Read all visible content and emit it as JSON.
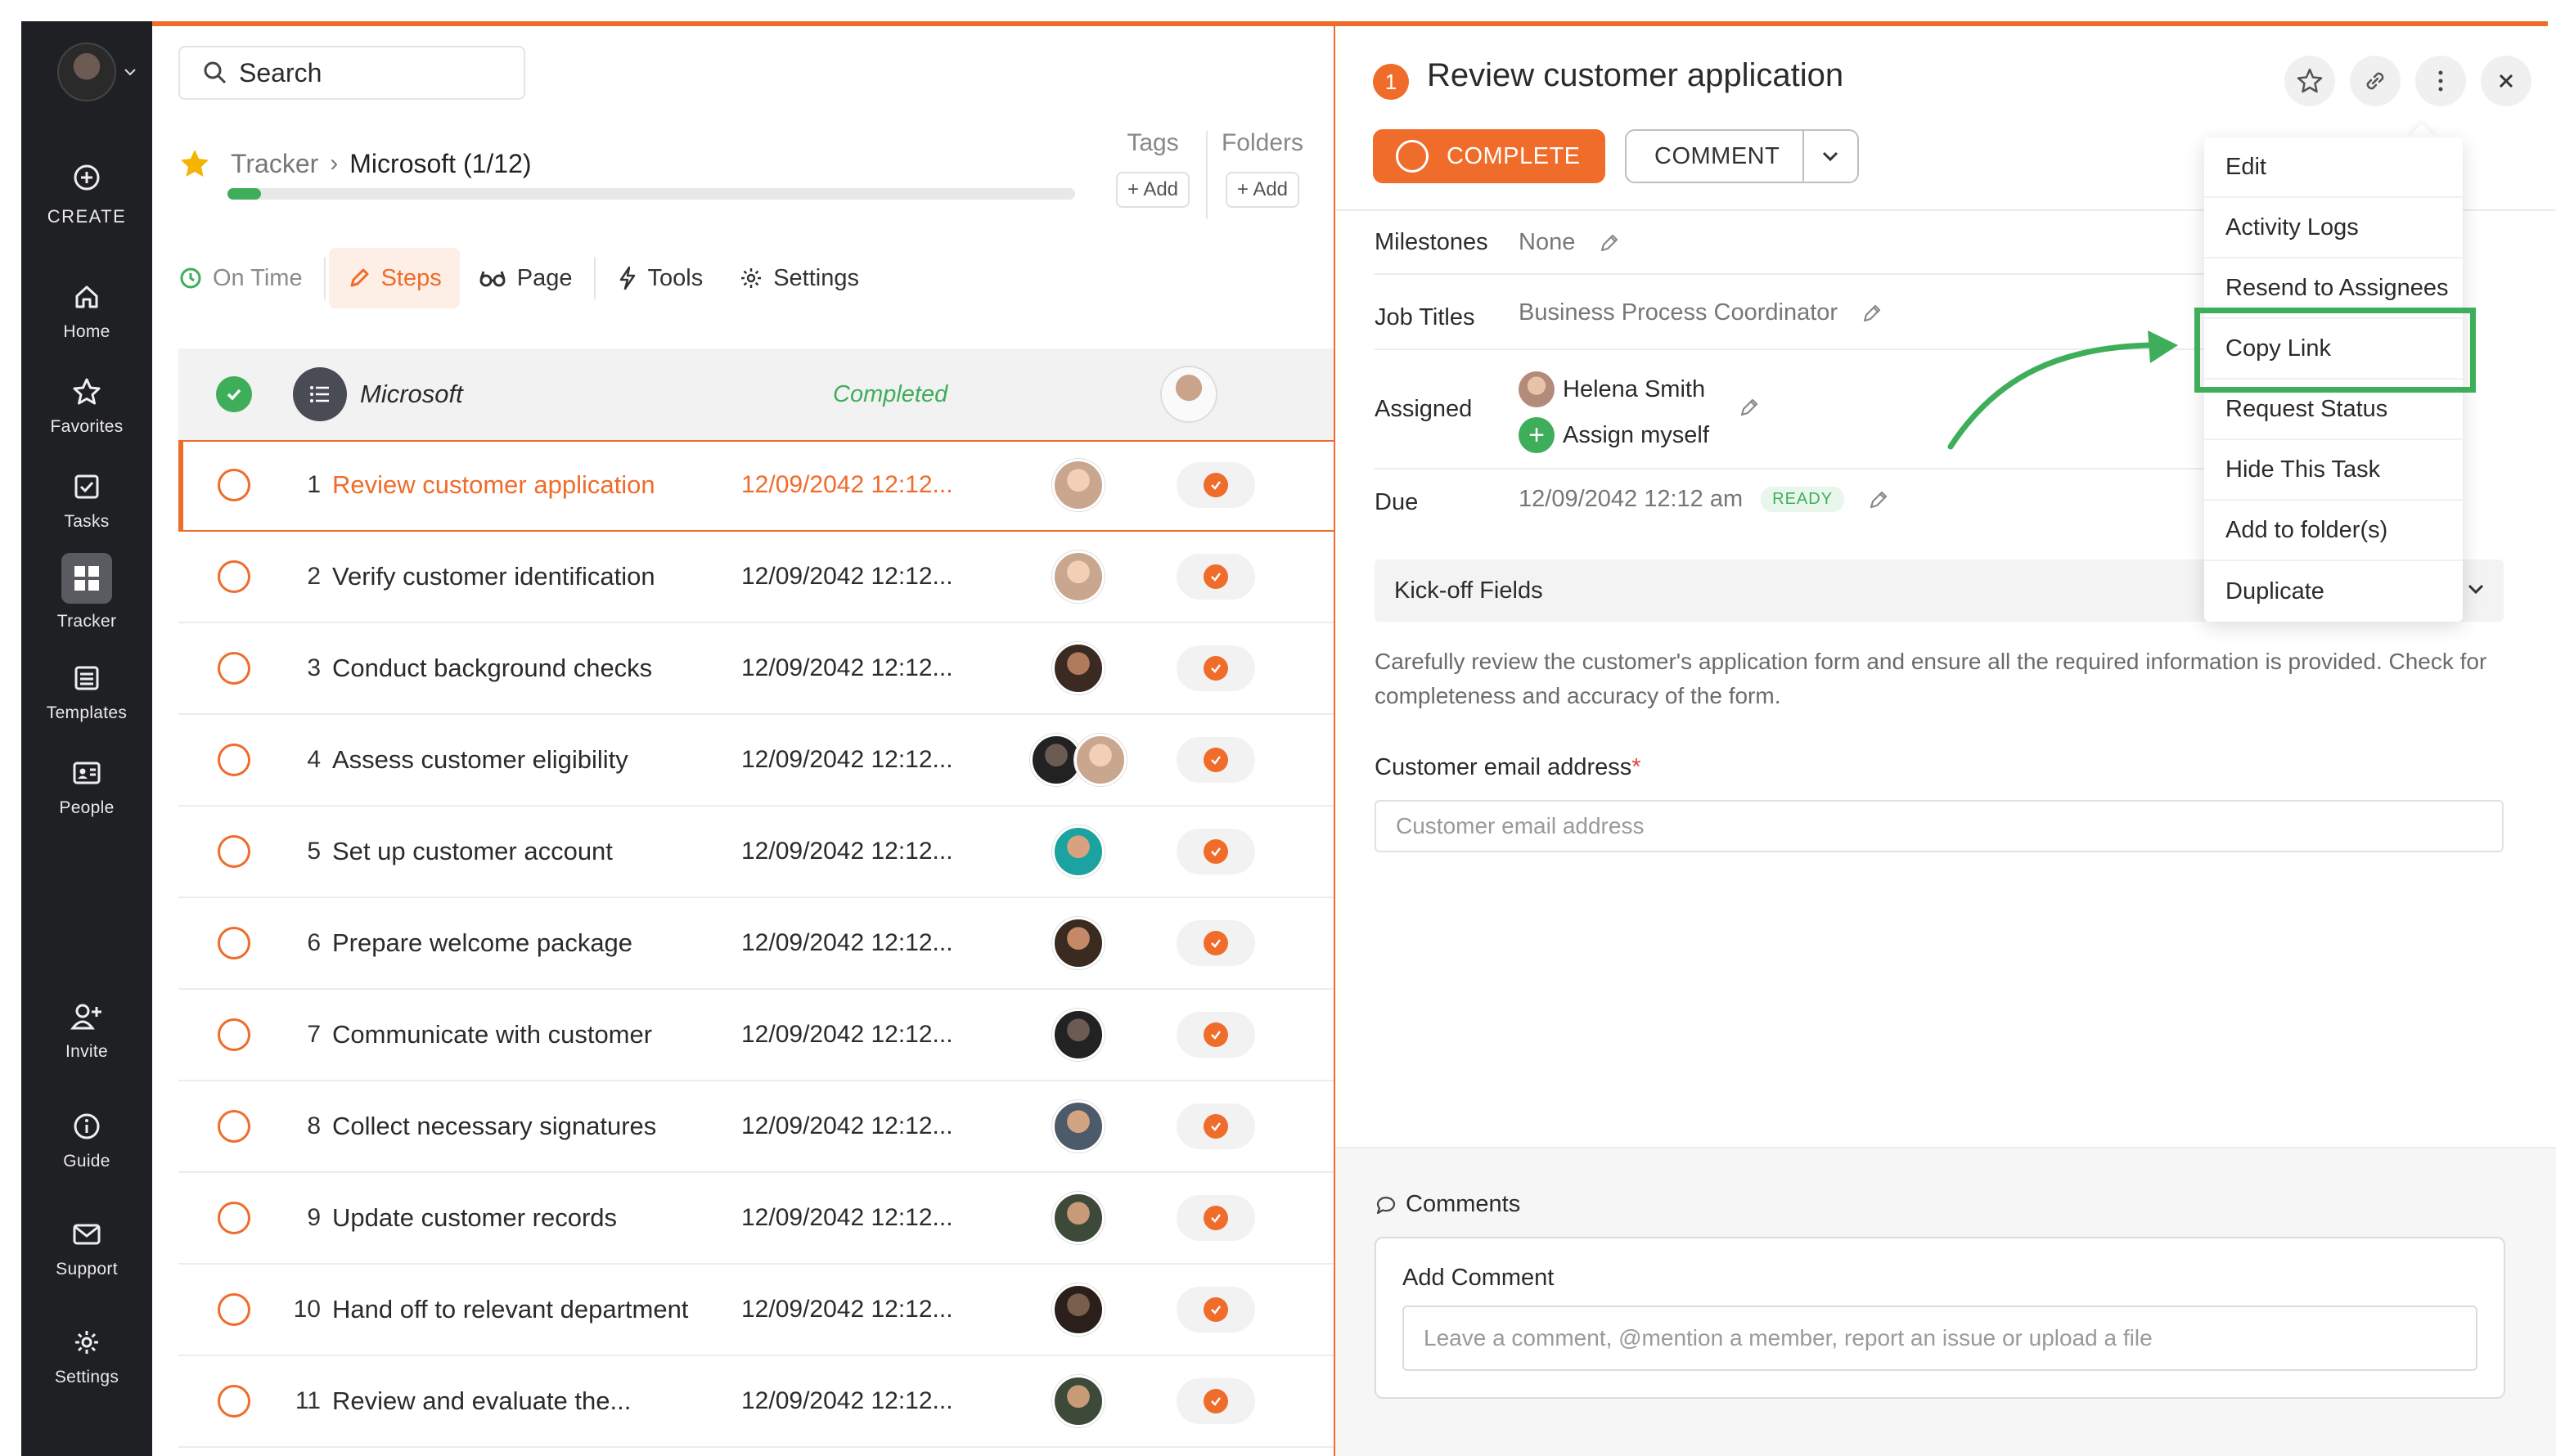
{
  "sidebar": {
    "create": "CREATE",
    "items": [
      {
        "label": "Home",
        "icon": "home-icon"
      },
      {
        "label": "Favorites",
        "icon": "star-icon"
      },
      {
        "label": "Tasks",
        "icon": "checkbox-icon"
      },
      {
        "label": "Tracker",
        "icon": "tracker-grid-icon"
      },
      {
        "label": "Templates",
        "icon": "templates-icon"
      },
      {
        "label": "People",
        "icon": "id-card-icon"
      }
    ],
    "bottom": [
      {
        "label": "Invite",
        "icon": "add-user-icon"
      },
      {
        "label": "Guide",
        "icon": "info-icon"
      },
      {
        "label": "Support",
        "icon": "mail-icon"
      },
      {
        "label": "Settings",
        "icon": "gear-icon"
      }
    ]
  },
  "search": {
    "label": "Search"
  },
  "breadcrumb": {
    "root": "Tracker",
    "sep": "›",
    "current": "Microsoft (1/12)",
    "progress": 0.04
  },
  "tags": {
    "title": "Tags",
    "add": "+ Add"
  },
  "folders": {
    "title": "Folders",
    "add": "+ Add"
  },
  "tabs": {
    "ontime": "On Time",
    "steps": "Steps",
    "page": "Page",
    "tools": "Tools",
    "settings": "Settings"
  },
  "group": {
    "name": "Microsoft",
    "status": "Completed"
  },
  "tasks": [
    {
      "num": "1",
      "title": "Review customer application",
      "date": "12/09/2042 12:12..."
    },
    {
      "num": "2",
      "title": "Verify customer identification",
      "date": "12/09/2042 12:12..."
    },
    {
      "num": "3",
      "title": "Conduct background checks",
      "date": "12/09/2042 12:12..."
    },
    {
      "num": "4",
      "title": "Assess customer eligibility",
      "date": "12/09/2042 12:12..."
    },
    {
      "num": "5",
      "title": "Set up customer account",
      "date": "12/09/2042 12:12..."
    },
    {
      "num": "6",
      "title": "Prepare welcome package",
      "date": "12/09/2042 12:12..."
    },
    {
      "num": "7",
      "title": "Communicate with customer",
      "date": "12/09/2042 12:12..."
    },
    {
      "num": "8",
      "title": "Collect necessary signatures",
      "date": "12/09/2042 12:12..."
    },
    {
      "num": "9",
      "title": "Update customer records",
      "date": "12/09/2042 12:12..."
    },
    {
      "num": "10",
      "title": "Hand off to relevant department",
      "date": "12/09/2042 12:12..."
    },
    {
      "num": "11",
      "title": "Review and evaluate the...",
      "date": "12/09/2042 12:12..."
    }
  ],
  "detail": {
    "badge": "1",
    "title": "Review customer application",
    "complete": "COMPLETE",
    "comment": "COMMENT",
    "milestones_label": "Milestones",
    "milestones_value": "None",
    "jobtitles_label": "Job Titles",
    "jobtitles_value": "Business Process Coordinator",
    "assigned_label": "Assigned",
    "assignee": "Helena Smith",
    "assign_myself": "Assign myself",
    "due_label": "Due",
    "due_value": "12/09/2042 12:12 am",
    "ready": "READY",
    "kickoff": "Kick-off Fields",
    "description": "Carefully review the customer's application form and ensure all the required information is provided. Check for completeness and accuracy of the form.",
    "email_label": "Customer email address",
    "email_required": "*",
    "email_placeholder": "Customer email address",
    "comments_title": "Comments",
    "add_comment": "Add Comment",
    "comment_placeholder": "Leave a comment, @mention a member, report an issue or upload a file"
  },
  "menu": [
    "Edit",
    "Activity Logs",
    "Resend to Assignees",
    "Copy Link",
    "Request Status",
    "Hide This Task",
    "Add to folder(s)",
    "Duplicate"
  ],
  "colors": {
    "accent": "#ef6c2a",
    "success": "#3fae5a",
    "sidebar": "#1f2023"
  }
}
